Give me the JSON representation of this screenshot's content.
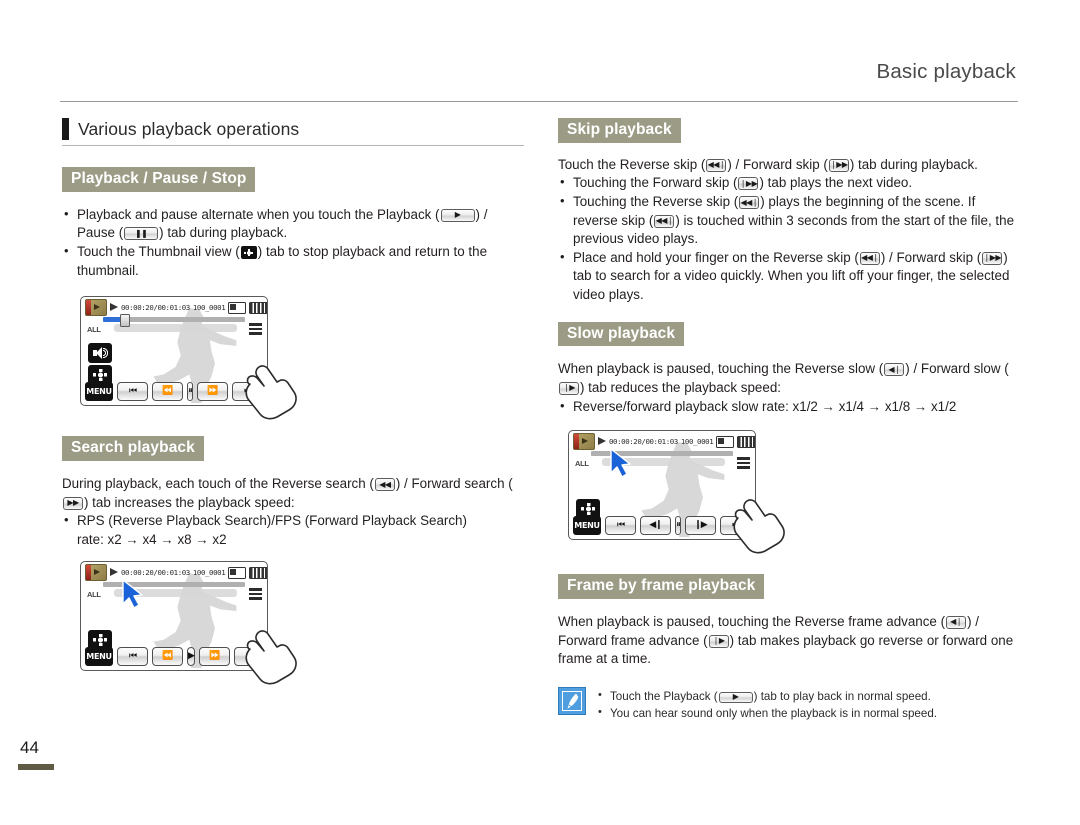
{
  "header": {
    "title": "Basic playback"
  },
  "page_number": "44",
  "section": {
    "title": "Various playback operations"
  },
  "left_column": {
    "playback_pause_stop": {
      "heading": "Playback / Pause / Stop",
      "bullets": [
        {
          "parts": [
            "Playback and pause alternate when you touch the Playback (",
            ") / Pause (",
            ") tab during playback."
          ],
          "icons": [
            "play-tab-icon",
            "pause-tab-icon"
          ]
        },
        {
          "parts": [
            "Touch the Thumbnail view (",
            ") tab to stop playback and return to the thumbnail."
          ],
          "icons": [
            "thumbnail-view-icon"
          ]
        }
      ]
    },
    "search_playback": {
      "heading": "Search playback",
      "intro_parts": [
        "During playback, each touch of the Reverse search (",
        ") / Forward search (",
        ") tab increases the playback speed:"
      ],
      "bullets": [
        "RPS (Reverse Playback Search)/FPS (Forward Playback Search)",
        "rate: x2 → x4 → x8 → x2"
      ]
    }
  },
  "right_column": {
    "skip_playback": {
      "heading": "Skip playback",
      "intro_parts": [
        "Touch the Reverse skip (",
        ") / Forward skip (",
        ") tab during playback."
      ],
      "bullets": [
        {
          "parts": [
            "Touching the Forward skip (",
            ") tab plays the next video."
          ]
        },
        {
          "parts": [
            "Touching the Reverse skip (",
            ") plays the beginning of the scene. If reverse skip (",
            ") is touched within 3 seconds from the start of the file, the previous video plays."
          ]
        },
        {
          "parts": [
            "Place and hold your finger on the Reverse skip (",
            ") / Forward skip (",
            ") tab to search for a video quickly. When you lift off your finger, the selected video plays."
          ]
        }
      ]
    },
    "slow_playback": {
      "heading": "Slow playback",
      "intro_parts": [
        "When playback is paused, touching the Reverse slow (",
        ") / Forward slow (",
        ") tab reduces the playback speed:"
      ],
      "bullets": [
        "Reverse/forward playback slow rate: x1/2 → x1/4 → x1/8 → x1/2"
      ]
    },
    "frame_by_frame": {
      "heading": "Frame by frame playback",
      "intro_parts": [
        "When playback is paused, touching the Reverse frame advance (",
        ") / Forward frame advance (",
        ") tab makes playback go reverse or forward one frame at a time."
      ]
    },
    "note": {
      "icon": "note-pen-icon",
      "items": [
        {
          "parts": [
            "Touch the Playback (",
            ") tab to play back in normal speed."
          ]
        },
        {
          "parts": [
            "You can hear sound only when the playback is in normal speed."
          ]
        }
      ]
    }
  },
  "lcd_screens": [
    {
      "id": "lcd-playback-pause",
      "timecode": "00:00:20/00:01:03",
      "filename": "100_0001",
      "labels": {
        "all": "ALL",
        "menu": "MENU"
      },
      "left_icons": [
        "speaker-icon",
        "thumbnail-view-icon"
      ],
      "controls": [
        "reverse-skip",
        "reverse-search",
        "pause",
        "forward-search",
        "forward-skip"
      ],
      "control_glyphs": [
        "⏮",
        "⏪",
        "⏸",
        "⏩",
        "⏭"
      ],
      "cursor": "none",
      "hand": true
    },
    {
      "id": "lcd-search-playback",
      "timecode": "00:00:20/00:01:03",
      "filename": "100_0001",
      "labels": {
        "all": "ALL",
        "menu": "MENU"
      },
      "left_icons": [
        "thumbnail-view-icon"
      ],
      "controls": [
        "reverse-skip",
        "reverse-search",
        "play",
        "forward-search",
        "forward-skip"
      ],
      "control_glyphs": [
        "⏮",
        "⏪",
        "▶",
        "⏩",
        "⏭"
      ],
      "cursor": "blue-arrow",
      "hand": true
    },
    {
      "id": "lcd-slow-playback",
      "timecode": "00:00:20/00:01:03",
      "filename": "100_0001",
      "labels": {
        "all": "ALL",
        "menu": "MENU"
      },
      "left_icons": [
        "thumbnail-view-icon"
      ],
      "controls": [
        "reverse-skip",
        "reverse-slow",
        "pause",
        "forward-slow",
        "forward-skip"
      ],
      "control_glyphs": [
        "⏮",
        "◀❙",
        "⏸",
        "❙▶",
        "⏭"
      ],
      "cursor": "blue-arrow",
      "hand": true
    }
  ],
  "colors": {
    "subhead_bg": "#9c9c86",
    "subhead_text": "#ffffff",
    "page_bar": "#5f5b45",
    "accent_blue": "#2e6fd8",
    "note_icon_bg": "#4f9fe0"
  }
}
